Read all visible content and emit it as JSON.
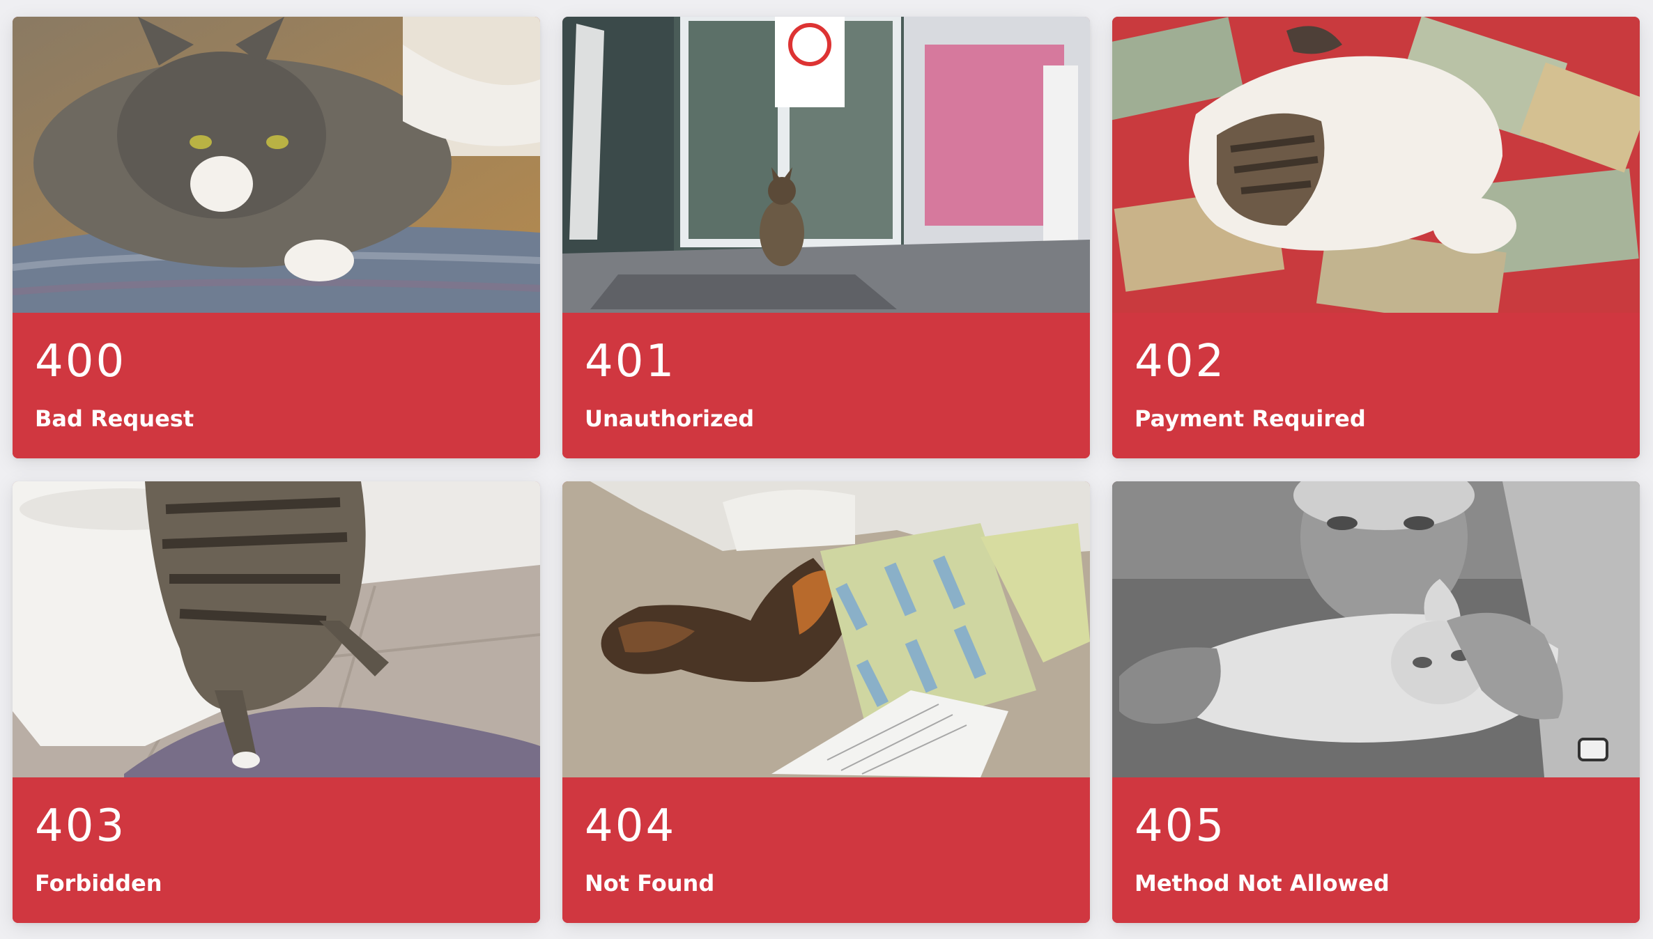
{
  "colors": {
    "card_caption": "#d03740",
    "page_background": "#efeff2",
    "caption_text": "#ffffff"
  },
  "cards": [
    {
      "code": "400",
      "label": "Bad Request",
      "image": "grey-tabby-cat-on-braided-rug-photo"
    },
    {
      "code": "401",
      "label": "Unauthorized",
      "image": "cat-sitting-at-glass-shop-door-photo"
    },
    {
      "code": "402",
      "label": "Payment Required",
      "image": "cat-lying-on-banknotes-photo"
    },
    {
      "code": "403",
      "label": "Forbidden",
      "image": "cat-climbing-toilet-photo"
    },
    {
      "code": "404",
      "label": "Not Found",
      "image": "cat-hiding-under-papers-photo"
    },
    {
      "code": "405",
      "label": "Method Not Allowed",
      "image": "man-holding-kitten-photo"
    }
  ]
}
